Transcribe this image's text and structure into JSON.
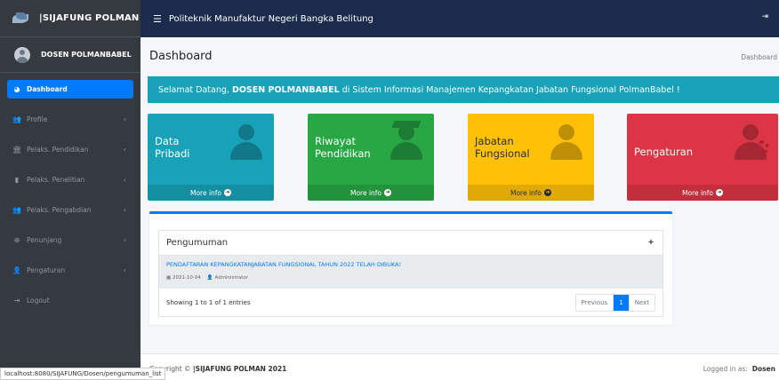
{
  "brand": {
    "name": "|SIJAFUNG POLMAN"
  },
  "user": {
    "name": "DOSEN POLMANBABEL"
  },
  "sidebar": {
    "items": [
      {
        "label": "Dashboard",
        "icon": "dashboard-icon"
      },
      {
        "label": "Profile",
        "icon": "users-icon"
      },
      {
        "label": "Pelaks. Pendidikan",
        "icon": "university-icon"
      },
      {
        "label": "Pelaks. Penelitian",
        "icon": "book-icon"
      },
      {
        "label": "Pelaks. Pengabdian",
        "icon": "people-icon"
      },
      {
        "label": "Penunjang",
        "icon": "plus-circle-icon"
      },
      {
        "label": "Pengaturan",
        "icon": "user-cog-icon"
      },
      {
        "label": "Logout",
        "icon": "logout-icon"
      }
    ]
  },
  "topbar": {
    "title": "Politeknik Manufaktur Negeri Bangka Belitung"
  },
  "page": {
    "title": "Dashboard",
    "breadcrumb": "Dashboard"
  },
  "welcome": {
    "prefix": "Selamat Datang, ",
    "name": "DOSEN POLMANBABEL",
    "suffix": " di Sistem Informasi Manajemen Kepangkatan Jabatan Fungsional PolmanBabel !"
  },
  "boxes": [
    {
      "line1": "Data",
      "line2": "Pribadi",
      "footer": "More info",
      "color": "#17a2b8"
    },
    {
      "line1": "Riwayat",
      "line2": "Pendidikan",
      "footer": "More info",
      "color": "#28a745"
    },
    {
      "line1": "Jabatan",
      "line2": "Fungsional",
      "footer": "More info",
      "color": "#ffc107"
    },
    {
      "line1": "Pengaturan",
      "footer": "More info",
      "color": "#dc3545"
    }
  ],
  "announcement": {
    "heading": "Pengumuman",
    "items": [
      {
        "title": "PENDAFTARAN KEPANGKATANJABATAN FUNGSIONAL TAHUN 2022 TELAH DIBUKA!",
        "date": "2021-10-04",
        "author": "Administrator"
      }
    ],
    "entries_text": "Showing 1 to 1 of 1 entries",
    "pager": {
      "previous": "Previous",
      "current": "1",
      "next": "Next"
    }
  },
  "footer": {
    "copyright_prefix": "Copyright ©",
    "copyright_brand": "|SIJAFUNG POLMAN 2021",
    "logged_prefix": "Logged in as: ",
    "logged_user": "Dosen"
  },
  "statusbar": {
    "url": "localhost:8080/SIJAFUNG/Dosen/pengumuman_list"
  }
}
